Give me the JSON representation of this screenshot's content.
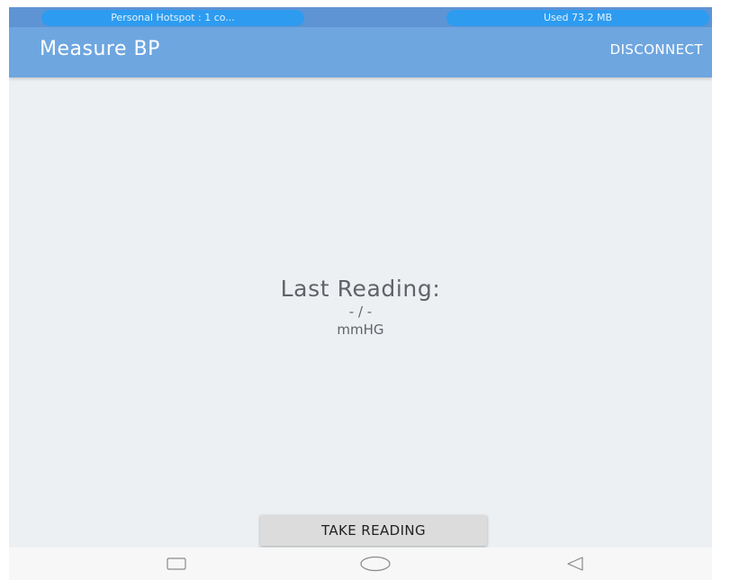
{
  "status_bar": {
    "hotspot_text": "Personal Hotspot : 1 co...",
    "data_usage_text": "Used  73.2 MB",
    "accent_color": "#2d9cf0"
  },
  "app_bar": {
    "title": "Measure BP",
    "disconnect_label": "DISCONNECT",
    "color": "#6ea6e0"
  },
  "reading": {
    "label": "Last Reading:",
    "value": "- / -",
    "unit": "mmHG"
  },
  "actions": {
    "take_reading_label": "TAKE READING"
  },
  "nav_bar": {
    "icons": [
      "recent-apps-icon",
      "home-icon",
      "back-icon"
    ]
  }
}
